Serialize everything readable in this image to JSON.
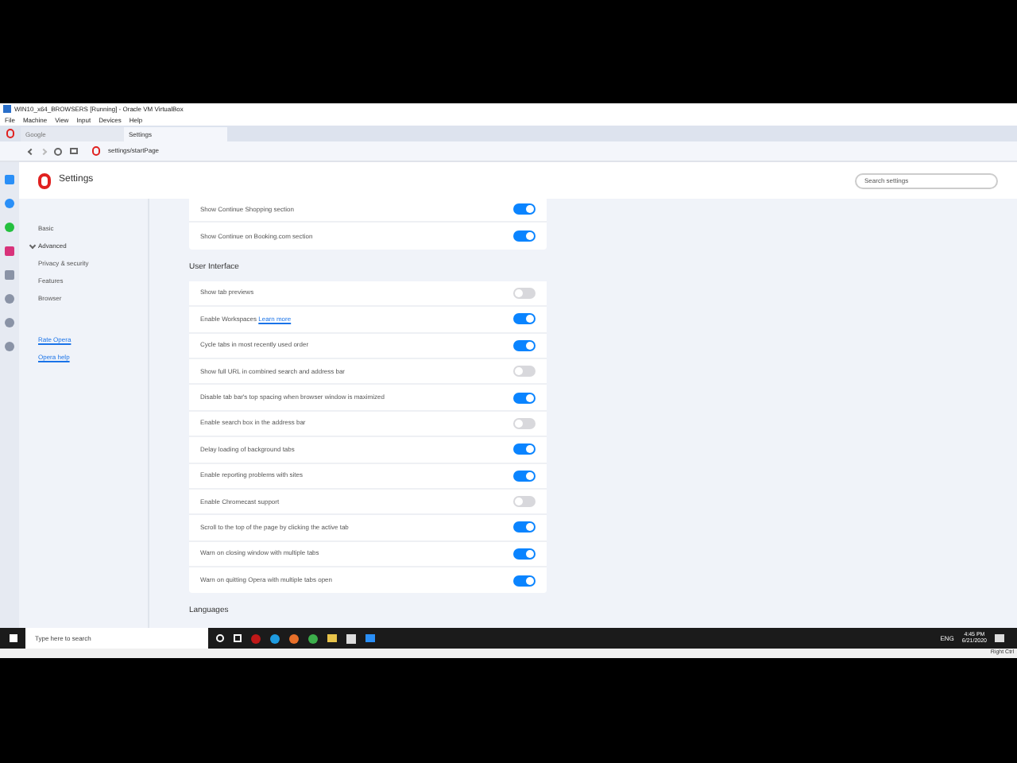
{
  "vm_window": {
    "title": "WIN10_x64_BROWSERS [Running] - Oracle VM VirtualBox",
    "menu": [
      "File",
      "Machine",
      "View",
      "Input",
      "Devices",
      "Help"
    ],
    "status_key": "Right Ctrl"
  },
  "tabs": [
    {
      "label": "Google",
      "selected": false
    },
    {
      "label": "Settings",
      "selected": true
    }
  ],
  "address": "settings/startPage",
  "header": {
    "title": "Settings",
    "search_placeholder": "Search settings"
  },
  "sidebar": {
    "items": [
      {
        "label": "Basic",
        "selected": false,
        "expanded": false
      },
      {
        "label": "Advanced",
        "selected": false,
        "expanded": true
      },
      {
        "label": "Privacy & security",
        "selected": false,
        "expanded": false
      },
      {
        "label": "Features",
        "selected": false,
        "expanded": false
      },
      {
        "label": "Browser",
        "selected": false,
        "expanded": false
      }
    ],
    "links": [
      "Rate Opera",
      "Opera help"
    ]
  },
  "sections": [
    {
      "rows": [
        {
          "label": "Show Continue Shopping section",
          "on": true
        },
        {
          "label": "Show Continue on Booking.com section",
          "on": true
        }
      ]
    },
    {
      "heading": "User Interface",
      "rows": [
        {
          "label": "Show tab previews",
          "on": false
        },
        {
          "label": "Enable Workspaces",
          "link": "Learn more",
          "on": true
        },
        {
          "label": "Cycle tabs in most recently used order",
          "on": true
        },
        {
          "label": "Show full URL in combined search and address bar",
          "on": false
        },
        {
          "label": "Disable tab bar's top spacing when browser window is maximized",
          "on": true
        },
        {
          "label": "Enable search box in the address bar",
          "on": false
        },
        {
          "label": "Delay loading of background tabs",
          "on": true
        },
        {
          "label": "Enable reporting problems with sites",
          "on": true
        },
        {
          "label": "Enable Chromecast support",
          "on": false
        },
        {
          "label": "Scroll to the top of the page by clicking the active tab",
          "on": true
        },
        {
          "label": "Warn on closing window with multiple tabs",
          "on": true
        },
        {
          "label": "Warn on quitting Opera with multiple tabs open",
          "on": true
        }
      ]
    },
    {
      "heading": "Languages"
    }
  ],
  "taskbar": {
    "search_placeholder": "Type here to search",
    "language": "ENG",
    "time": "4:45 PM",
    "date": "6/21/2020"
  }
}
